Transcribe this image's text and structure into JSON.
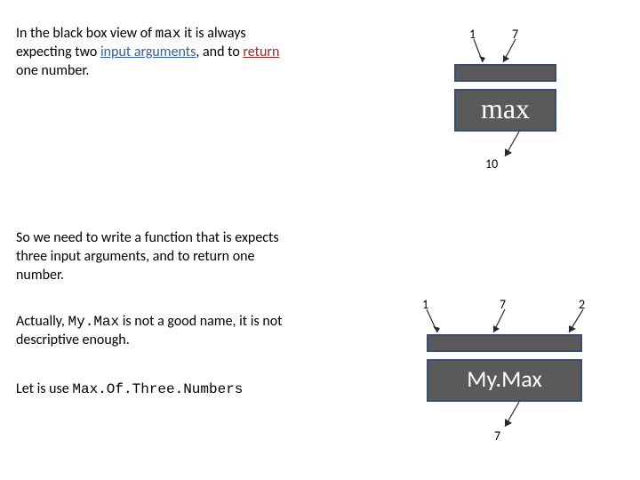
{
  "para1": {
    "pre": "In the black box view of ",
    "code": "max",
    "mid": " it is always expecting two ",
    "link1": "input arguments",
    "mid2": ", and to ",
    "link2": "return",
    "post": " one number."
  },
  "para2": "So we need to write a function that is expects three input arguments, and to return one number.",
  "para3": {
    "pre": "Actually, ",
    "code": "My.Max",
    "post": " is not a good name, it is not descriptive enough."
  },
  "para4": {
    "pre": "Let is use ",
    "code": "Max.Of.Three.Numbers"
  },
  "box1": {
    "label": "max",
    "in": [
      "1",
      "7"
    ],
    "out": "10"
  },
  "box2": {
    "label": "My.Max",
    "in": [
      "1",
      "7",
      "2"
    ],
    "out": "7"
  }
}
